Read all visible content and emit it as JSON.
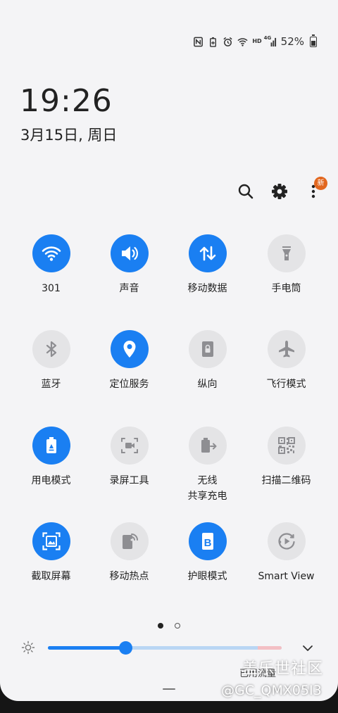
{
  "status_bar": {
    "icons": [
      "nfc-icon",
      "battery-saver-icon",
      "alarm-icon",
      "wifi-icon",
      "hd-icon",
      "4g-signal-icon"
    ],
    "hd_label": "HD",
    "net_label": "4G",
    "battery_percent": "52%",
    "battery_level": 0.52
  },
  "clock": {
    "time": "19:26",
    "date": "3月15日, 周日"
  },
  "top_actions": {
    "icons": [
      "search-icon",
      "settings-gear-icon",
      "more-vert-icon"
    ],
    "new_badge": "新"
  },
  "tiles": [
    {
      "id": "wifi",
      "label": "301",
      "label2": "",
      "icon": "wifi-icon",
      "active": true
    },
    {
      "id": "sound",
      "label": "声音",
      "label2": "",
      "icon": "speaker-icon",
      "active": true
    },
    {
      "id": "mobile-data",
      "label": "移动数据",
      "label2": "",
      "icon": "data-arrows-icon",
      "active": true
    },
    {
      "id": "flashlight",
      "label": "手电筒",
      "label2": "",
      "icon": "flashlight-icon",
      "active": false
    },
    {
      "id": "bluetooth",
      "label": "蓝牙",
      "label2": "",
      "icon": "bluetooth-icon",
      "active": false
    },
    {
      "id": "location",
      "label": "定位服务",
      "label2": "",
      "icon": "location-pin-icon",
      "active": true
    },
    {
      "id": "orientation",
      "label": "纵向",
      "label2": "",
      "icon": "portrait-lock-icon",
      "active": false
    },
    {
      "id": "airplane",
      "label": "飞行模式",
      "label2": "",
      "icon": "airplane-icon",
      "active": false
    },
    {
      "id": "power-mode",
      "label": "用电模式",
      "label2": "",
      "icon": "battery-recycle-icon",
      "active": true
    },
    {
      "id": "screen-recorder",
      "label": "录屏工具",
      "label2": "",
      "icon": "screen-record-icon",
      "active": false
    },
    {
      "id": "wireless-share",
      "label": "无线",
      "label2": "共享充电",
      "icon": "wireless-powershare-icon",
      "active": false
    },
    {
      "id": "qr-scan",
      "label": "扫描二维码",
      "label2": "",
      "icon": "qr-code-icon",
      "active": false
    },
    {
      "id": "screenshot",
      "label": "截取屏幕",
      "label2": "",
      "icon": "screenshot-icon",
      "active": true
    },
    {
      "id": "hotspot",
      "label": "移动热点",
      "label2": "",
      "icon": "hotspot-icon",
      "active": false
    },
    {
      "id": "eye-comfort",
      "label": "护眼模式",
      "label2": "",
      "icon": "eye-comfort-icon",
      "active": true
    },
    {
      "id": "smart-view",
      "label": "Smart View",
      "label2": "",
      "icon": "smart-view-icon",
      "active": false
    }
  ],
  "pager": {
    "pages": 2,
    "current": 1
  },
  "brightness": {
    "level": 0.33,
    "expand_icon": "chevron-down-icon",
    "sun_icon": "brightness-sun-icon"
  },
  "footer": {
    "text": "已用流量"
  },
  "watermarks": {
    "line1": "盖乐世社区",
    "line2": "@GC_QMX05I3"
  }
}
